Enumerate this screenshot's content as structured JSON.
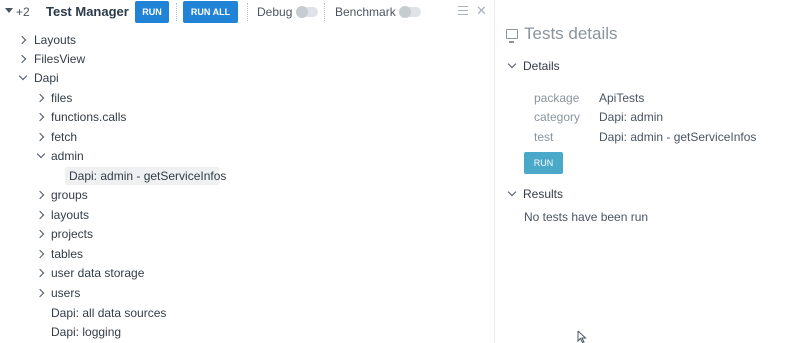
{
  "toolbar": {
    "count": "+2",
    "title": "Test Manager",
    "run_label": "RUN",
    "run_all_label": "RUN ALL",
    "debug_label": "Debug",
    "benchmark_label": "Benchmark",
    "debug_on": false,
    "benchmark_on": false
  },
  "tree": {
    "items": [
      {
        "label": "Layouts",
        "expanded": false
      },
      {
        "label": "FilesView",
        "expanded": false
      },
      {
        "label": "Dapi",
        "expanded": true
      },
      {
        "label": "files",
        "expanded": false
      },
      {
        "label": "functions.calls",
        "expanded": false
      },
      {
        "label": "fetch",
        "expanded": false
      },
      {
        "label": "admin",
        "expanded": true
      },
      {
        "label": "Dapi: admin - getServiceInfos",
        "selected": true
      },
      {
        "label": "groups",
        "expanded": false
      },
      {
        "label": "layouts",
        "expanded": false
      },
      {
        "label": "projects",
        "expanded": false
      },
      {
        "label": "tables",
        "expanded": false
      },
      {
        "label": "user data storage",
        "expanded": false
      },
      {
        "label": "users",
        "expanded": false
      },
      {
        "label": "Dapi: all data sources"
      },
      {
        "label": "Dapi: logging"
      }
    ]
  },
  "details": {
    "title": "Tests details",
    "section_details": "Details",
    "props": [
      {
        "key": "package",
        "value": "ApiTests"
      },
      {
        "key": "category",
        "value": "Dapi: admin"
      },
      {
        "key": "test",
        "value": "Dapi: admin - getServiceInfos"
      }
    ],
    "run_label": "RUN",
    "section_results": "Results",
    "results_text": "No tests have been run"
  },
  "colors": {
    "primary_button": "#2083d5",
    "secondary_button": "#4aa8c8",
    "selected_row": "#eef0f2"
  }
}
